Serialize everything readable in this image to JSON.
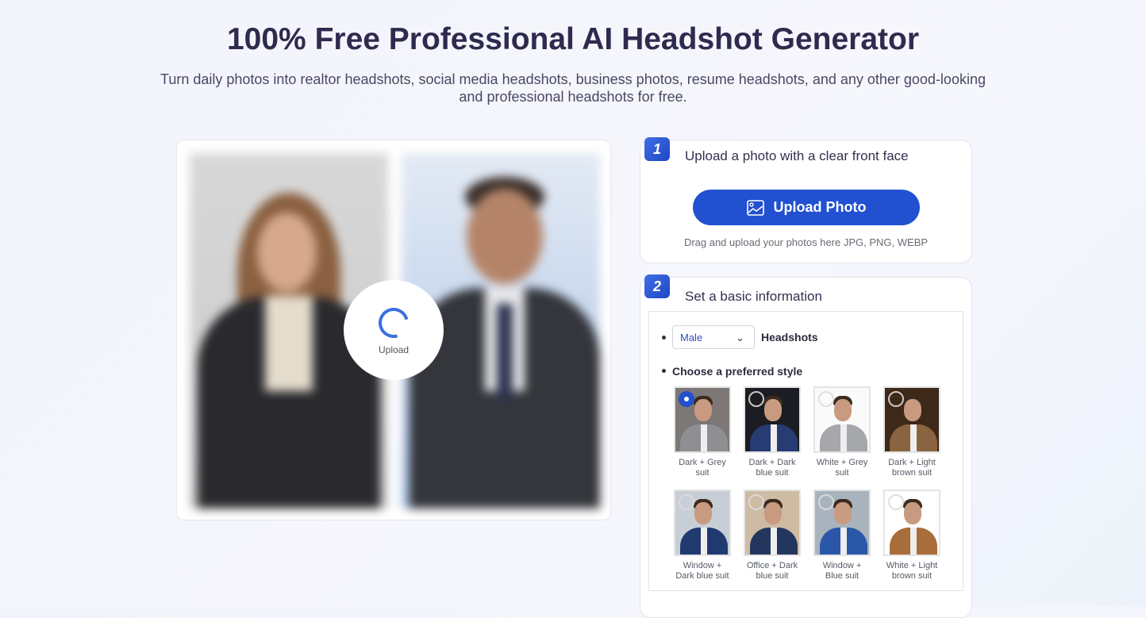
{
  "header": {
    "title": "100% Free Professional AI Headshot Generator",
    "subtitle": "Turn daily photos into realtor headshots, social media headshots, business photos, resume headshots, and any other good-looking and professional headshots for free."
  },
  "preview": {
    "upload_label": "Upload",
    "upload_icon": "spinner-icon"
  },
  "step1": {
    "number": "1",
    "title": "Upload a photo with a clear front face",
    "button": "Upload Photo",
    "button_icon": "image-icon",
    "hint": "Drag and upload your photos here JPG, PNG, WEBP"
  },
  "step2": {
    "number": "2",
    "title": "Set a basic information",
    "gender": "Male",
    "headshots_label": "Headshots",
    "style_label": "Choose a preferred style",
    "styles": [
      {
        "label": "Dark + Grey suit",
        "selected": true,
        "bg": "#7d7775",
        "suit": "#8e8f93"
      },
      {
        "label": "Dark + Dark blue suit",
        "selected": false,
        "bg": "#1c1d22",
        "suit": "#263c72"
      },
      {
        "label": "White + Grey suit",
        "selected": false,
        "bg": "#fafafa",
        "suit": "#a5a7ab"
      },
      {
        "label": "Dark + Light brown suit",
        "selected": false,
        "bg": "#3e2818",
        "suit": "#8a6440"
      },
      {
        "label": "Window + Dark blue suit",
        "selected": false,
        "bg": "#c8ced6",
        "suit": "#203a70"
      },
      {
        "label": "Office + Dark blue suit",
        "selected": false,
        "bg": "#cdbba3",
        "suit": "#25365e"
      },
      {
        "label": "Window + Blue suit",
        "selected": false,
        "bg": "#a9b3be",
        "suit": "#2a57a8"
      },
      {
        "label": "White + Light brown suit",
        "selected": false,
        "bg": "#ffffff",
        "suit": "#a86d3a"
      }
    ]
  },
  "colors": {
    "accent": "#2150d0",
    "title": "#2f2b4e"
  }
}
